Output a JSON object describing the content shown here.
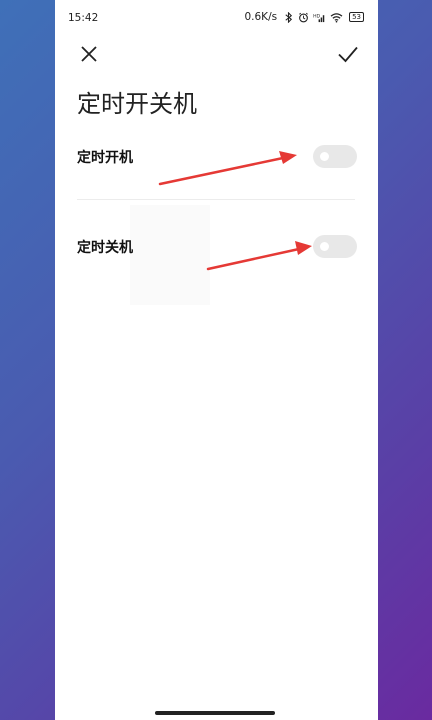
{
  "status_bar": {
    "time": "15:42",
    "network_speed": "0.6K/s",
    "battery": "53",
    "icons": [
      "bluetooth-icon",
      "alarm-icon",
      "hd-icon",
      "signal-icon",
      "wifi-icon",
      "battery-icon"
    ]
  },
  "header": {
    "close_icon": "close-icon",
    "confirm_icon": "check-icon"
  },
  "page": {
    "title": "定时开关机"
  },
  "settings": [
    {
      "label": "定时开机",
      "enabled": false
    },
    {
      "label": "定时关机",
      "enabled": false
    }
  ],
  "colors": {
    "background_gradient": [
      "#3f70b8",
      "#6a2aa0"
    ],
    "toggle_off": "#e8e8e8",
    "arrow": "#e53935"
  }
}
